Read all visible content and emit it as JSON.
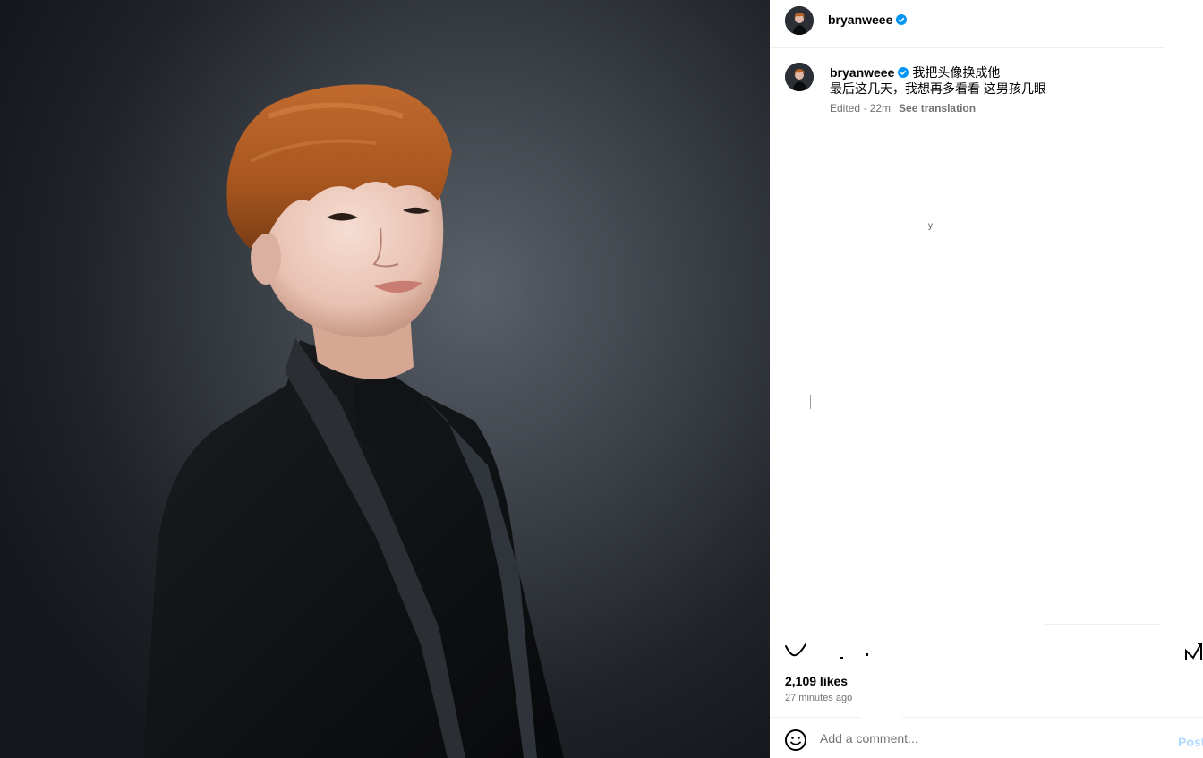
{
  "post": {
    "username": "bryanweee",
    "verified": true
  },
  "caption": {
    "username": "bryanweee",
    "line1": "我把头像换成他",
    "line2": "最后这几天，我想再多看看 这男孩几眼",
    "edited": "Edited · 22m",
    "see_translation": "See translation"
  },
  "stray_text": "y",
  "likes": "2,109 likes",
  "time_ago": "27 minutes ago",
  "comment": {
    "placeholder": "Add a comment...",
    "post_label": "Post"
  },
  "colors": {
    "verified": "#0095f6",
    "post_disabled": "#b3dbff",
    "muted_text": "#737373"
  },
  "icons": [
    "heart-icon",
    "bookmark-icon",
    "emoji-icon",
    "verified-badge-icon"
  ]
}
